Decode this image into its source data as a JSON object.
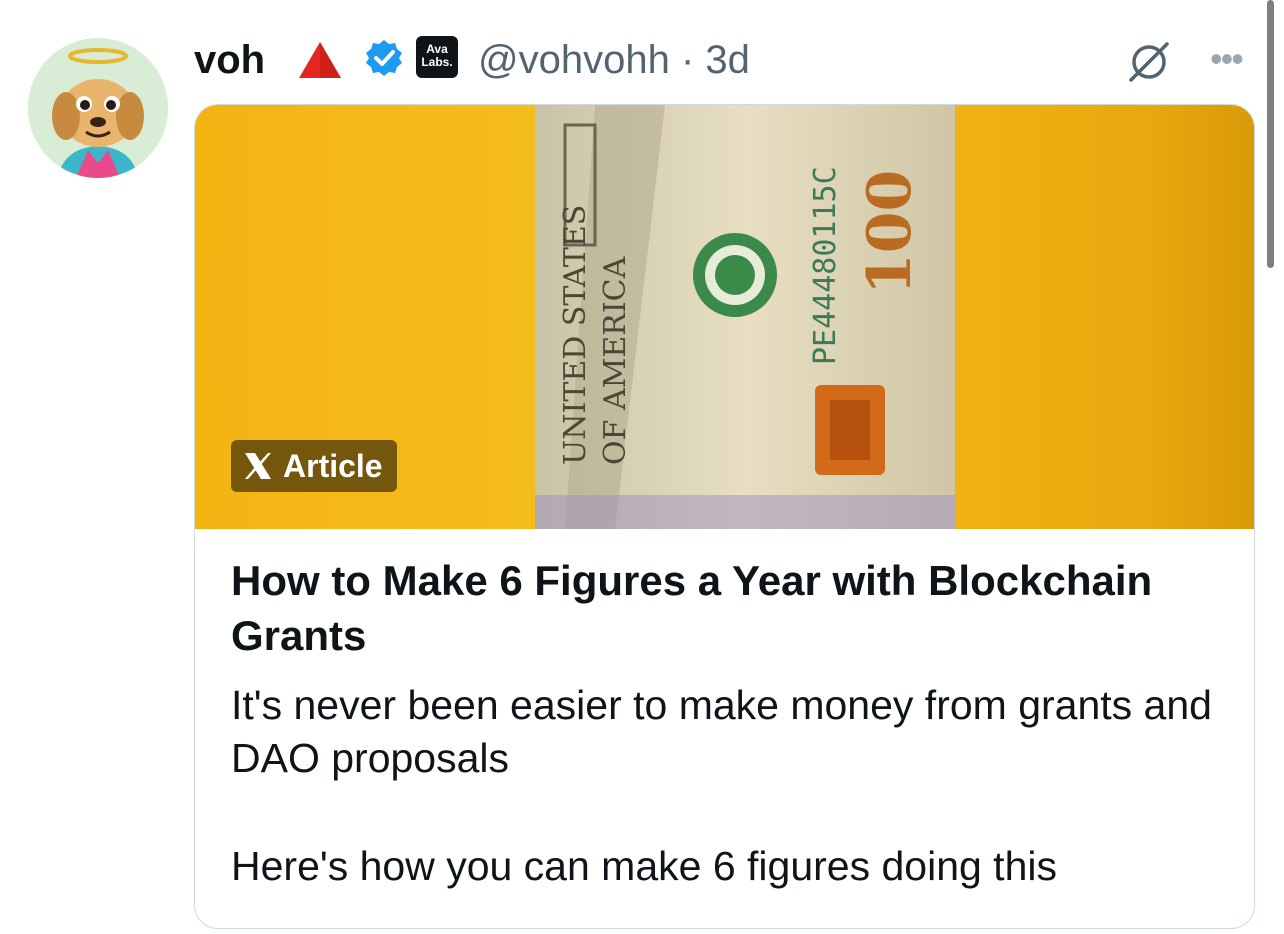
{
  "tweet": {
    "author_name": "voh",
    "handle_and_time": "@vohvohh · 3d",
    "affiliation_badge": "Ava Labs.",
    "icons": [
      "avatar-dog-with-halo",
      "red-triangle-emoji",
      "verified-badge",
      "ava-labs-badge",
      "grok-icon",
      "more-icon"
    ]
  },
  "article": {
    "badge_label": "Article",
    "title": "How to Make 6 Figures a Year with Blockchain Grants",
    "description": "It's never been easier to make money from grants and DAO proposals",
    "description_2": "Here's how you can make 6 figures doing this",
    "image_description_colors": {
      "background": "#f3b412",
      "bill": "#d8d2b8"
    }
  },
  "colors": {
    "verified": "#1d9bf0",
    "text": "#0f1419",
    "secondary": "#536471",
    "border": "#cfd9de"
  }
}
